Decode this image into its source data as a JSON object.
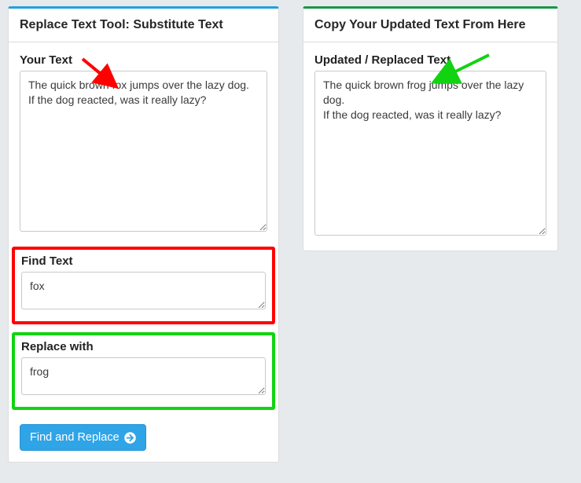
{
  "left": {
    "title": "Replace Text Tool: Substitute Text",
    "yourTextLabel": "Your Text",
    "yourText": "The quick brown fox jumps over the lazy dog.\nIf the dog reacted, was it really lazy?",
    "findLabel": "Find Text",
    "findText": "fox",
    "replaceLabel": "Replace with",
    "replaceText": "frog",
    "buttonLabel": "Find and Replace"
  },
  "right": {
    "title": "Copy Your Updated Text From Here",
    "outputLabel": "Updated / Replaced Text",
    "outputText": "The quick brown frog jumps over the lazy dog.\nIf the dog reacted, was it really lazy?"
  },
  "annotations": {
    "arrow_red": "arrow-red",
    "arrow_green": "arrow-green"
  }
}
